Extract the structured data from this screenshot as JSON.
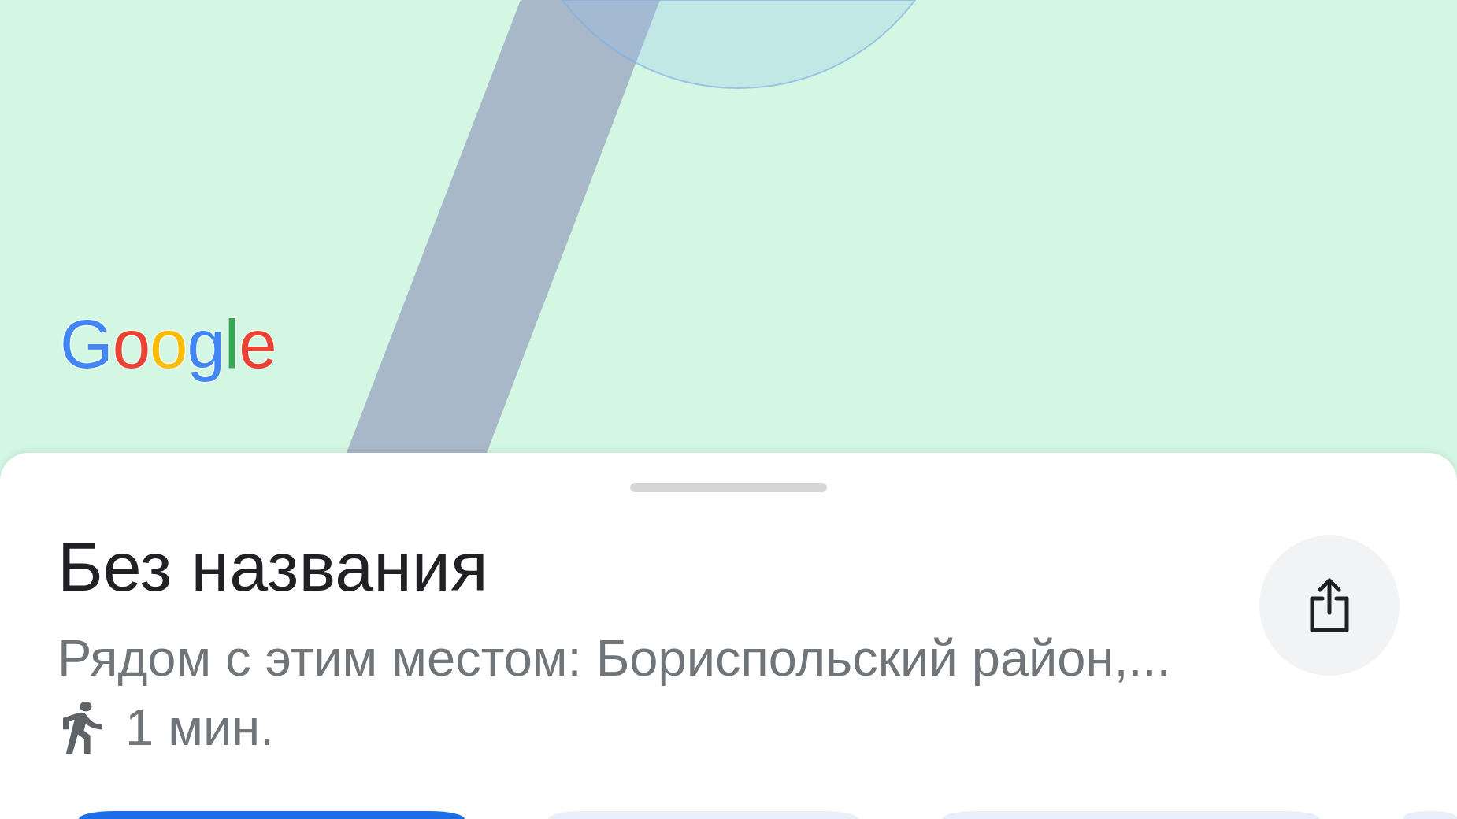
{
  "map": {
    "logo": "Google"
  },
  "place_sheet": {
    "title": "Без названия",
    "nearby": "Рядом с этим местом: Бориспольский район,...",
    "travel_time": "1 мин."
  },
  "action_buttons": [
    {
      "kind": "primary"
    },
    {
      "kind": "tonal"
    },
    {
      "kind": "tonal"
    },
    {
      "kind": "tonal"
    }
  ]
}
